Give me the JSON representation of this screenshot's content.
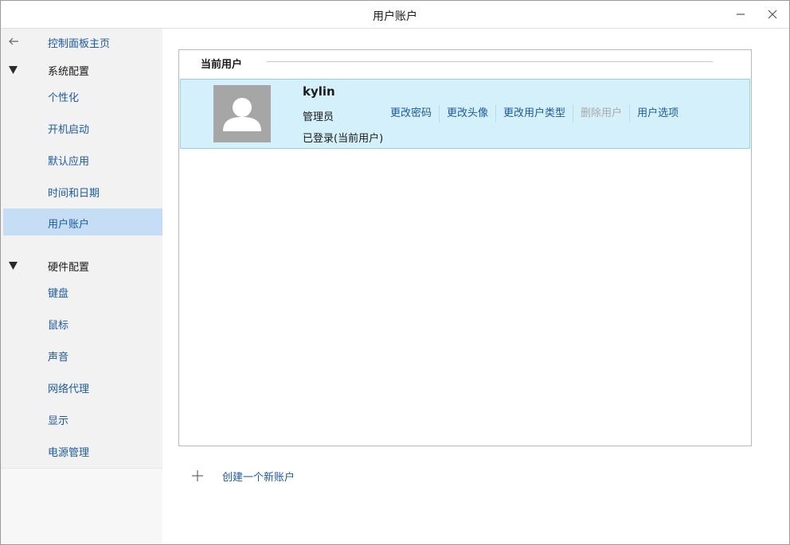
{
  "window": {
    "title": "用户账户"
  },
  "sidebar": {
    "home_link": "控制面板主页",
    "categories": [
      {
        "label": "系统配置",
        "items": [
          "个性化",
          "开机启动",
          "默认应用",
          "时间和日期",
          "用户账户"
        ]
      },
      {
        "label": "硬件配置",
        "items": [
          "键盘",
          "鼠标",
          "声音",
          "网络代理",
          "显示",
          "电源管理"
        ]
      }
    ],
    "selected": "用户账户"
  },
  "main": {
    "section_title": "当前用户",
    "user": {
      "name": "kylin",
      "role": "管理员",
      "status": "已登录(当前用户)",
      "actions": {
        "change_password": "更改密码",
        "change_avatar": "更改头像",
        "change_type": "更改用户类型",
        "delete_user": "删除用户",
        "user_options": "用户选项"
      }
    },
    "add_account": "创建一个新账户"
  },
  "colors": {
    "link": "#1c5aa6",
    "selected_bg": "#c5def5",
    "user_row_bg": "#d3f0fb",
    "disabled": "#a9a9a9"
  }
}
